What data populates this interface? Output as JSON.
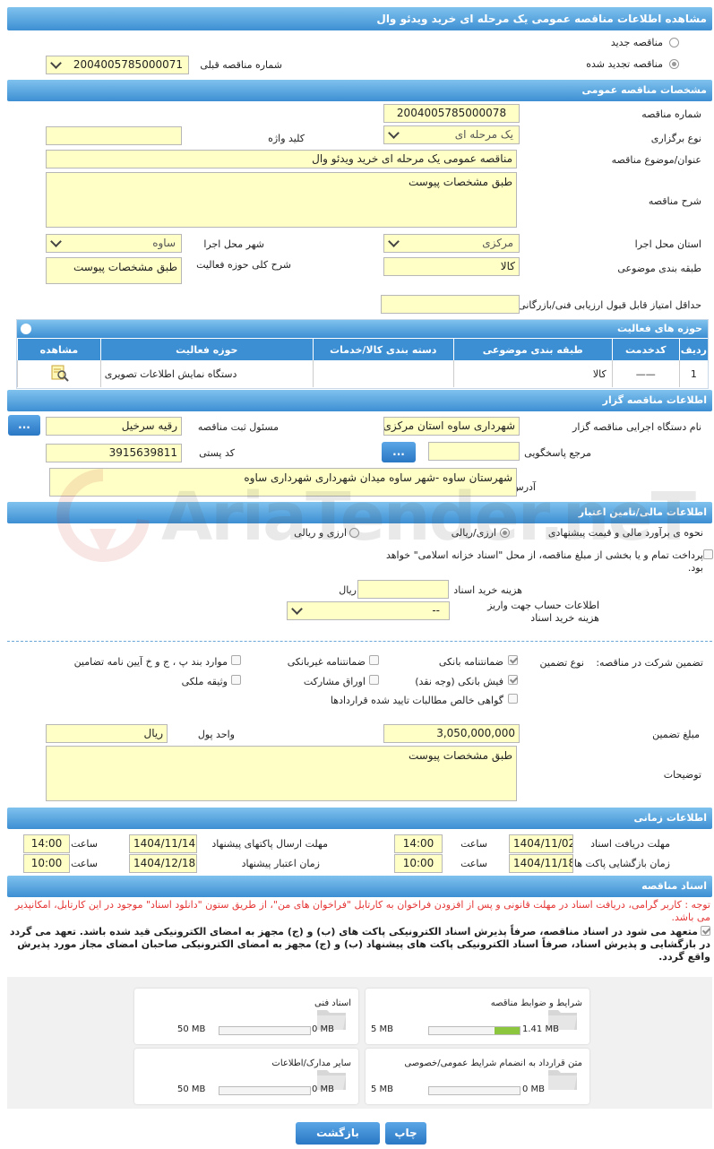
{
  "page_title": "مشاهده اطلاعات مناقصه عمومی یک مرحله ای خرید ویدئو وال",
  "tender_type": {
    "new_label": "مناقصه جدید",
    "renewed_label": "مناقصه تجدید شده",
    "prev_number_label": "شماره مناقصه قبلی",
    "prev_number_value": "2004005785000071"
  },
  "general": {
    "header": "مشخصات مناقصه عمومی",
    "number_label": "شماره مناقصه",
    "number_value": "2004005785000078",
    "holding_label": "نوع برگزاری",
    "holding_value": "یک مرحله ای",
    "keyword_label": "کلید واژه",
    "keyword_value": "",
    "subject_label": "عنوان/موضوع مناقصه",
    "subject_value": "مناقصه عمومی یک مرحله ای خرید ویدئو وال",
    "description_label": "شرح مناقصه",
    "description_value": "طبق مشخصات پیوست",
    "province_label": "استان محل اجرا",
    "province_value": "مرکزی",
    "city_label": "شهر محل اجرا",
    "city_value": "ساوه",
    "category_label": "طبقه بندی موضوعی",
    "category_value": "کالا",
    "scope_label": "شرح کلی حوزه فعالیت",
    "scope_value": "طبق مشخصات پیوست",
    "min_score_label": "حداقل امتیاز قابل قبول ارزیابی فنی/بازرگانی",
    "min_score_value": ""
  },
  "activity": {
    "header": "حوزه های فعالیت",
    "columns": [
      "ردیف",
      "کدخدمت",
      "طبقه بندی موضوعی",
      "دسته بندی کالا/خدمات",
      "حوزه فعالیت",
      "مشاهده"
    ],
    "rows": [
      {
        "index": "1",
        "code": "——",
        "category": "کالا",
        "group": "",
        "field": "دستگاه نمایش اطلاعات تصویری"
      }
    ]
  },
  "organizer": {
    "header": "اطلاعات مناقصه گزار",
    "org_label": "نام دستگاه اجرایی مناقصه گزار",
    "org_value": "شهرداری ساوه استان مرکزی",
    "registrar_label": "مسئول ثبت مناقصه",
    "registrar_value": "رقیه  سرخیل",
    "reference_label": "مرجع پاسخگویی",
    "reference_value": "",
    "postal_label": "کد پستی",
    "postal_value": "3915639811",
    "address_label": "آدرس",
    "address_value": "شهرستان  ساوه  -شهر  ساوه  میدان  شهرداری شهرداری  ساوه",
    "more_button": "..."
  },
  "financial": {
    "header": "اطلاعات مالی/تامین اعتبار",
    "estimate_label": "نحوه ی برآورد مالی و قیمت پیشنهادی",
    "opt_rial": "ارزی/ریالی",
    "opt_both": "ارزی و ریالی",
    "payment_note": "پرداخت تمام و یا بخشی از مبلغ مناقصه، از محل \"اسناد خزانه اسلامی\" خواهد بود.",
    "doc_cost_label": "هزینه خرید اسناد",
    "doc_cost_unit": "ریال",
    "doc_cost_value": "",
    "account_label": "اطلاعات حساب جهت واریز هزینه خرید اسناد",
    "account_value": "--"
  },
  "guarantee": {
    "participation_label": "تضمین شرکت در مناقصه:",
    "type_label": "نوع تضمین",
    "options": {
      "bank": "ضمانتنامه بانکی",
      "nonbank": "ضمانتنامه غیربانکی",
      "clauses": "موارد بند پ ، ج و خ آیین نامه تضامین",
      "cash": "فیش بانکی (وجه نقد)",
      "bonds": "اوراق مشارکت",
      "property": "وثیقه ملکی",
      "claims": "گواهی خالص مطالبات تایید شده قراردادها"
    },
    "amount_label": "مبلغ تضمین",
    "amount_value": "3,050,000,000",
    "currency_label": "واحد پول",
    "currency_value": "ریال",
    "notes_label": "توضیحات",
    "notes_value": "طبق مشخصات پیوست"
  },
  "timing": {
    "header": "اطلاعات زمانی",
    "doc_receive_label": "مهلت دریافت اسناد",
    "doc_receive_date": "1404/11/02",
    "doc_receive_time": "14:00",
    "submit_label": "مهلت ارسال پاکتهای پیشنهاد",
    "submit_date": "1404/11/14",
    "submit_time": "14:00",
    "opening_label": "زمان بازگشایی پاکت ها",
    "opening_date": "1404/11/18",
    "opening_time": "10:00",
    "validity_label": "زمان اعتبار پیشنهاد",
    "validity_date": "1404/12/18",
    "validity_time": "10:00",
    "time_label": "ساعت"
  },
  "documents": {
    "header": "اسناد مناقصه",
    "notice": "توجه : کاربر گرامی، دریافت اسناد در مهلت قانونی و پس از افزودن فراخوان به کارتابل \"فراخوان های من\"، از طریق ستون \"دانلود اسناد\" موجود در این کارتابل، امکانپذیر می باشد.",
    "commitment": "متعهد می شود در اسناد مناقصه، صرفاً پذیرش اسناد الکترونیکی پاکت های (ب) و (ج) مجهز به امضای الکترونیکی قید شده باشد. تعهد می گردد در بازگشایی و پذیرش اسناد، صرفاً اسناد الکترونیکی پاکت های پیشنهاد (ب) و (ج) مجهز به امضای الکترونیکی صاحبان امضای مجاز مورد پذیرش واقع گردد.",
    "cards": [
      {
        "title": "شرایط و ضوابط مناقصه",
        "used": "1.41 MB",
        "max": "5 MB",
        "fill": 0.28
      },
      {
        "title": "اسناد فنی",
        "used": "0 MB",
        "max": "50 MB",
        "fill": 0
      },
      {
        "title": "متن قرارداد به انضمام شرایط عمومی/خصوصی",
        "used": "0 MB",
        "max": "5 MB",
        "fill": 0
      },
      {
        "title": "سایر مدارک/اطلاعات",
        "used": "0 MB",
        "max": "50 MB",
        "fill": 0
      }
    ]
  },
  "footer": {
    "print_label": "چاپ",
    "back_label": "بازگشت"
  },
  "watermark": "AriaTender.neT",
  "colors": {
    "header_blue": "#3d8fd3",
    "input_yellow": "#ffffc6",
    "notice_red": "#e53535",
    "progress_green": "#8cc63f"
  }
}
